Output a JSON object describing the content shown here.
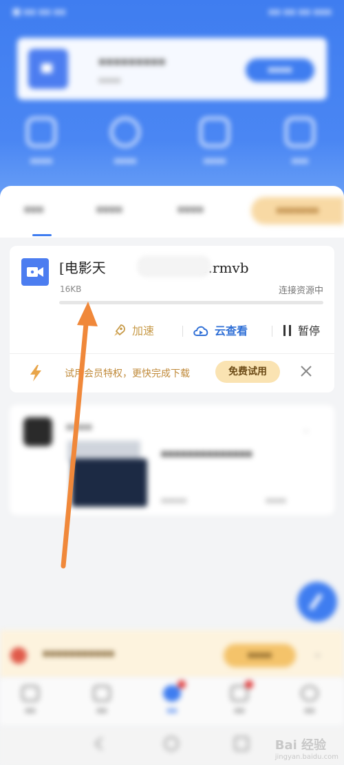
{
  "status_bar": {
    "left": "■ ▪▪ ▪▪ ▪▪",
    "right": "▪▪ ▪▪ ▪▪ ▪▪▪"
  },
  "promo": {
    "title": "▪▪▪▪▪▪▪▪▪",
    "subtitle": "▪▪▪▪",
    "button": "▪▪▪▪"
  },
  "quick_actions": [
    {
      "label": "▪▪▪▪",
      "icon": "box-icon"
    },
    {
      "label": "▪▪▪▪",
      "icon": "clock-icon"
    },
    {
      "label": "▪▪▪▪",
      "icon": "star-icon"
    },
    {
      "label": "▪▪▪",
      "icon": "trash-icon"
    }
  ],
  "tabs": [
    {
      "label": "▪▪▪"
    },
    {
      "label": "▪▪▪▪"
    },
    {
      "label": "▪▪▪▪"
    }
  ],
  "vip_tab": "▪▪▪▪▪▪▪",
  "download": {
    "file_name_start": "[电影天",
    "file_name_end": "cd1.rmvb",
    "size": "16KB",
    "status": "连接资源中",
    "progress_percent": 0,
    "accent_color": "#3f7df0",
    "actions": {
      "speed": {
        "label": "加速",
        "icon": "rocket-icon",
        "color": "#c79a48"
      },
      "cloud": {
        "label": "云查看",
        "icon": "cloud-play-icon",
        "color": "#2f6fd6"
      },
      "pause": {
        "label": "暂停",
        "icon": "pause-icon"
      }
    },
    "vip_banner": {
      "text": "试用会员特权，更快完成下载",
      "button": "免费试用",
      "icon": "lightning-icon"
    }
  },
  "feed": {
    "author": "▪▪▪▪",
    "title": "▪▪▪▪▪▪▪▪▪▪▪▪▪▪",
    "meta_left": "▪▪▪▪▪",
    "meta_right": "▪▪▪▪"
  },
  "bottom_promo": {
    "text": "▪▪▪▪▪▪▪▪▪▪▪",
    "button": "▪▪▪▪"
  },
  "nav_items": [
    {
      "label": "▪▪"
    },
    {
      "label": "▪▪"
    },
    {
      "label": "▪▪"
    },
    {
      "label": "▪▪"
    },
    {
      "label": "▪▪"
    }
  ],
  "watermark": {
    "brand": "Bai 经验",
    "sub": "jingyan.baidu.com"
  }
}
